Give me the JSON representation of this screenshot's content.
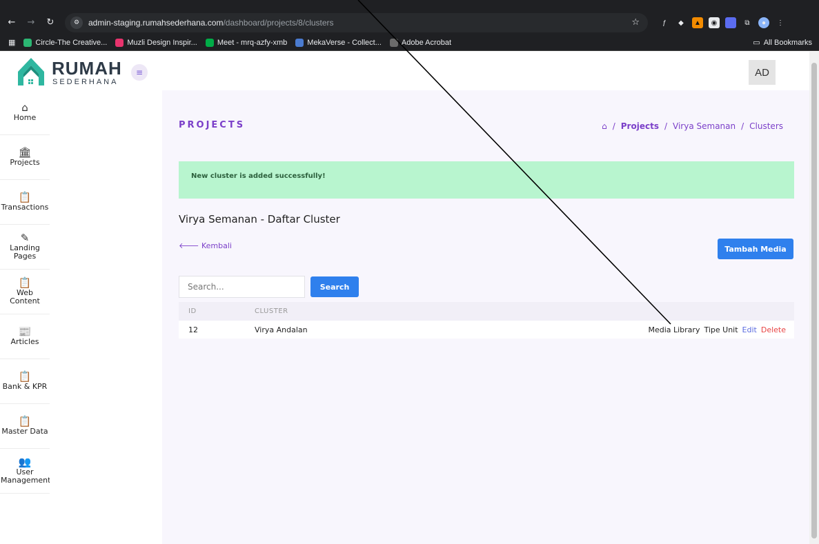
{
  "browser": {
    "url_host": "admin-staging.rumahsederhana.com",
    "url_path": "/dashboard/projects/8/clusters",
    "bookmarks": [
      {
        "label": "Circle-The Creative...",
        "color": "#2bb673"
      },
      {
        "label": "Muzli Design Inspir...",
        "color": "#e8336d"
      },
      {
        "label": "Meet - mrq-azfy-xmb",
        "color": "#00ac47"
      },
      {
        "label": "MekaVerse - Collect...",
        "color": "#4a7bd0"
      },
      {
        "label": "Adobe Acrobat",
        "color": "#6b6b6b"
      }
    ],
    "all_bookmarks": "All Bookmarks"
  },
  "brand": {
    "name": "RUMAH",
    "sub": "SEDERHANA",
    "color": "#2fb7a0"
  },
  "user": {
    "initials": "AD"
  },
  "sidebar": {
    "items": [
      {
        "label": "Home",
        "icon": "home-icon",
        "glyph": "⌂"
      },
      {
        "label": "Projects",
        "icon": "projects-icon",
        "glyph": "🏛"
      },
      {
        "label": "Transactions",
        "icon": "clipboard-icon",
        "glyph": "📋"
      },
      {
        "label": "Landing Pages",
        "icon": "edit-icon",
        "glyph": "✎"
      },
      {
        "label": "Web Content",
        "icon": "clipboard-icon",
        "glyph": "📋"
      },
      {
        "label": "Articles",
        "icon": "articles-icon",
        "glyph": "📰"
      },
      {
        "label": "Bank & KPR",
        "icon": "clipboard-icon",
        "glyph": "📋"
      },
      {
        "label": "Master Data",
        "icon": "clipboard-icon",
        "glyph": "📋"
      },
      {
        "label": "User Management",
        "icon": "users-icon",
        "glyph": "👥"
      }
    ]
  },
  "page": {
    "title": "PROJECTS",
    "breadcrumb": {
      "home_icon": "home-icon",
      "projects": "Projects",
      "project": "Virya Semanan",
      "current": "Clusters",
      "sep": "/"
    },
    "alert": "New cluster is added successfully!",
    "section_title": "Virya Semanan - Daftar Cluster",
    "back_label": "Kembali",
    "add_button": "Tambah Media",
    "search": {
      "placeholder": "Search...",
      "button": "Search"
    },
    "table": {
      "headers": {
        "id": "ID",
        "cluster": "CLUSTER"
      },
      "rows": [
        {
          "id": "12",
          "cluster": "Virya Andalan",
          "actions": {
            "media": "Media Library",
            "tipe": "Tipe Unit",
            "edit": "Edit",
            "delete": "Delete"
          }
        }
      ]
    }
  },
  "colors": {
    "accent": "#7b3fc9",
    "primary_button": "#2f80ed",
    "alert_bg": "#b8f5cf",
    "delete": "#e84545",
    "edit": "#5a6be0"
  }
}
